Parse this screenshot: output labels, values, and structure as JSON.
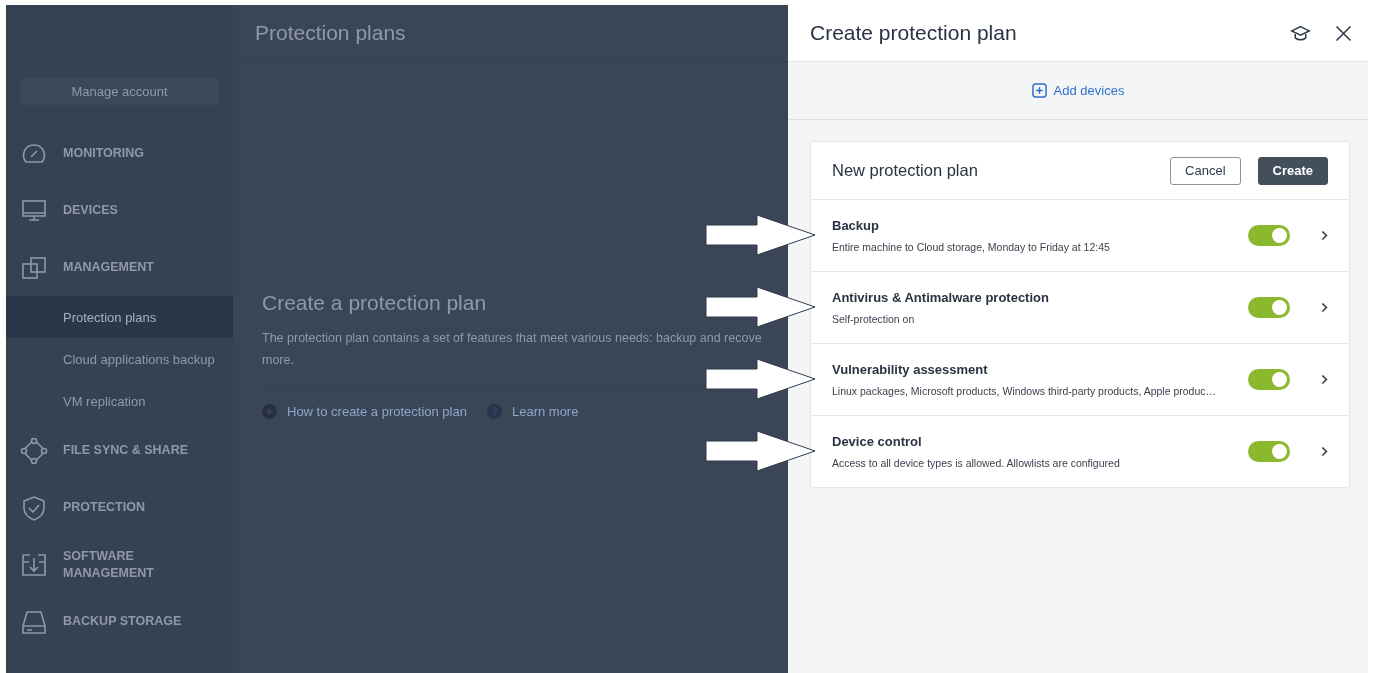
{
  "sidebar": {
    "manage_account": "Manage account",
    "items": [
      {
        "label": "MONITORING"
      },
      {
        "label": "DEVICES"
      },
      {
        "label": "MANAGEMENT",
        "children": [
          {
            "label": "Protection plans",
            "selected": true
          },
          {
            "label": "Cloud applications backup",
            "selected": false
          },
          {
            "label": "VM replication",
            "selected": false
          }
        ]
      },
      {
        "label": "FILE SYNC & SHARE"
      },
      {
        "label": "PROTECTION"
      },
      {
        "label": "SOFTWARE MANAGEMENT"
      },
      {
        "label": "BACKUP STORAGE"
      }
    ]
  },
  "main": {
    "title": "Protection plans",
    "empty_state": {
      "title": "Create a protection plan",
      "description_lines": [
        "The protection plan contains a set of features that meet various needs: backup and recove",
        "more."
      ],
      "links": [
        "How to create a protection plan",
        "Learn more"
      ]
    }
  },
  "panel": {
    "title": "Create protection plan",
    "add_devices": "Add devices",
    "plan": {
      "name": "New protection plan",
      "buttons": [
        "Cancel",
        "Create"
      ],
      "features": [
        {
          "title": "Backup",
          "description": "Entire machine to Cloud storage, Monday to Friday at 12:45",
          "on": true
        },
        {
          "title": "Antivirus & Antimalware protection",
          "description": "Self-protection on",
          "on": true
        },
        {
          "title": "Vulnerability assessment",
          "description": "Linux packages, Microsoft products, Windows third-party products, Apple produc…",
          "on": true
        },
        {
          "title": "Device control",
          "description": "Access to all device types is allowed. Allowlists are configured",
          "on": true
        }
      ]
    }
  }
}
